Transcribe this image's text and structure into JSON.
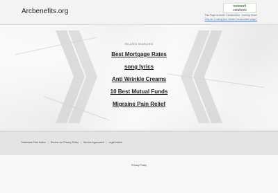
{
  "header": {
    "site_name": "Arcbenefits.org",
    "logo_line1": "network",
    "logo_line2": "solutions",
    "uc_notice": "This Page is Under Construction - Coming Soon!",
    "uc_link": "Why am I seeing this 'Under Construction' page?"
  },
  "main": {
    "related_label": "RELATED SEARCHES",
    "links": [
      {
        "label": "Best Mortgage Rates"
      },
      {
        "label": "song lyrics"
      },
      {
        "label": "Anti Wrinkle Creams"
      },
      {
        "label": "10 Best Mutual Funds"
      },
      {
        "label": "Migraine Pain Relief"
      }
    ]
  },
  "footer": {
    "links": [
      {
        "label": "Trademark Free Notice"
      },
      {
        "label": "Review our Privacy Policy"
      },
      {
        "label": "Service Agreement"
      },
      {
        "label": "Legal Notice"
      }
    ],
    "privacy": "Privacy Policy"
  },
  "colors": {
    "logo_green": "#3c8a2e",
    "link_color": "#1c1c1c",
    "uc_link_color": "#4a6fa8"
  }
}
